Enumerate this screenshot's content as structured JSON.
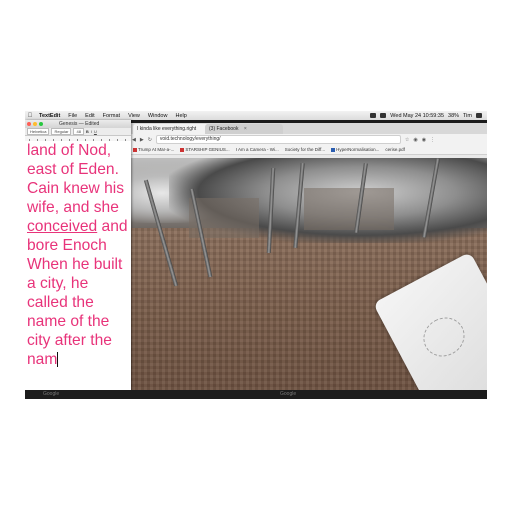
{
  "menubar": {
    "app": "TextEdit",
    "items": [
      "File",
      "Edit",
      "Format",
      "View",
      "Window",
      "Help"
    ],
    "clock": "Wed May 24  10:59:35",
    "battery": "38%",
    "user": "Tim"
  },
  "textedit": {
    "title": "Genesis",
    "edited": "— Edited",
    "font_style": "Helvetica",
    "font_weight": "Regular",
    "font_size": "48",
    "lines": [
      "land of Nod,",
      "east of Eden.",
      "Cain knew his",
      "wife, and she",
      "conceived and",
      "bore Enoch",
      "When he built",
      "a city, he",
      "called the",
      "name of the",
      "city after the",
      "nam"
    ]
  },
  "browser": {
    "tabs": [
      {
        "label": "I kinda like everything.right"
      },
      {
        "label": "(3) Facebook"
      }
    ],
    "address": "void.technology/everything/",
    "bookmarks": [
      "Trump At Mar-a-...",
      "STARSHIP GENIUS...",
      "I Am a Camera - Wi...",
      "Society for the Diff...",
      "HyperNormalisation...",
      "cerise.pdf"
    ]
  },
  "dock": {
    "label_left": "Google",
    "label_right": "Google"
  },
  "colors": {
    "text_pink": "#e8337a",
    "chrome_bg": "#e9e9e9"
  }
}
